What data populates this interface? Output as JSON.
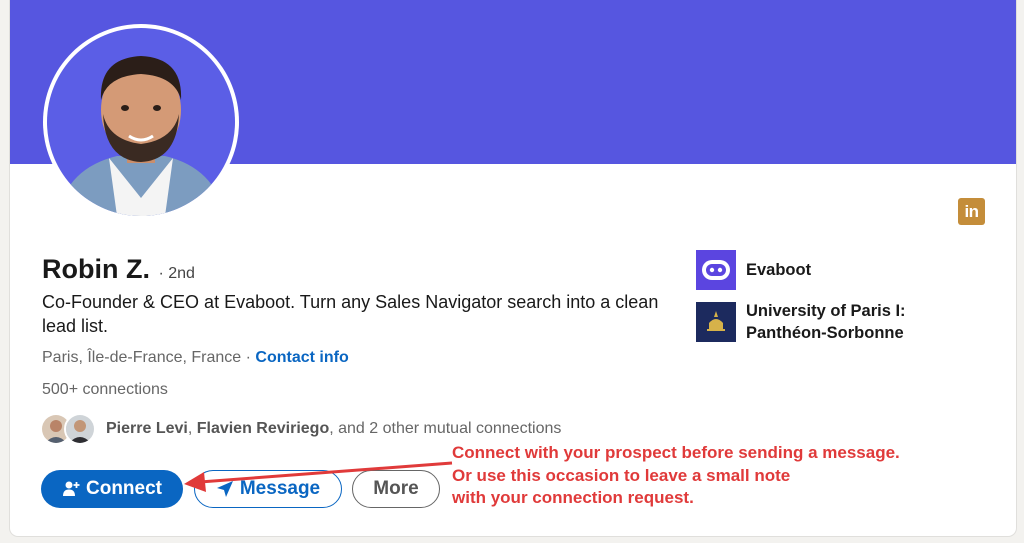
{
  "profile": {
    "name": "Robin Z.",
    "degree": "· 2nd",
    "headline": "Co-Founder & CEO at Evaboot. Turn any Sales Navigator search into a clean lead list.",
    "location": "Paris, Île-de-France, France",
    "location_sep": " · ",
    "contact_info": "Contact info",
    "connections": "500+ connections",
    "mutual": {
      "name1": "Pierre Levi",
      "sep": ", ",
      "name2": "Flavien Reviriego",
      "rest": ", and 2 other mutual connections"
    }
  },
  "actions": {
    "connect": "Connect",
    "message": "Message",
    "more": "More"
  },
  "organizations": [
    {
      "name": "Evaboot",
      "logo": "evaboot-logo"
    },
    {
      "name_line1": "University of Paris I:",
      "name_line2": "Panthéon-Sorbonne",
      "logo": "pantheon-logo"
    }
  ],
  "badge": {
    "text": "in",
    "icon": "linkedin-icon"
  },
  "annotation": {
    "line1": "Connect with your prospect before sending a message.",
    "line2": "Or use this occasion to leave a small note",
    "line3": "with your connection request."
  },
  "colors": {
    "banner": "#5656e0",
    "primary": "#0a66c2",
    "annotation": "#e03a3a",
    "linkedin_badge": "#c48d3a"
  }
}
